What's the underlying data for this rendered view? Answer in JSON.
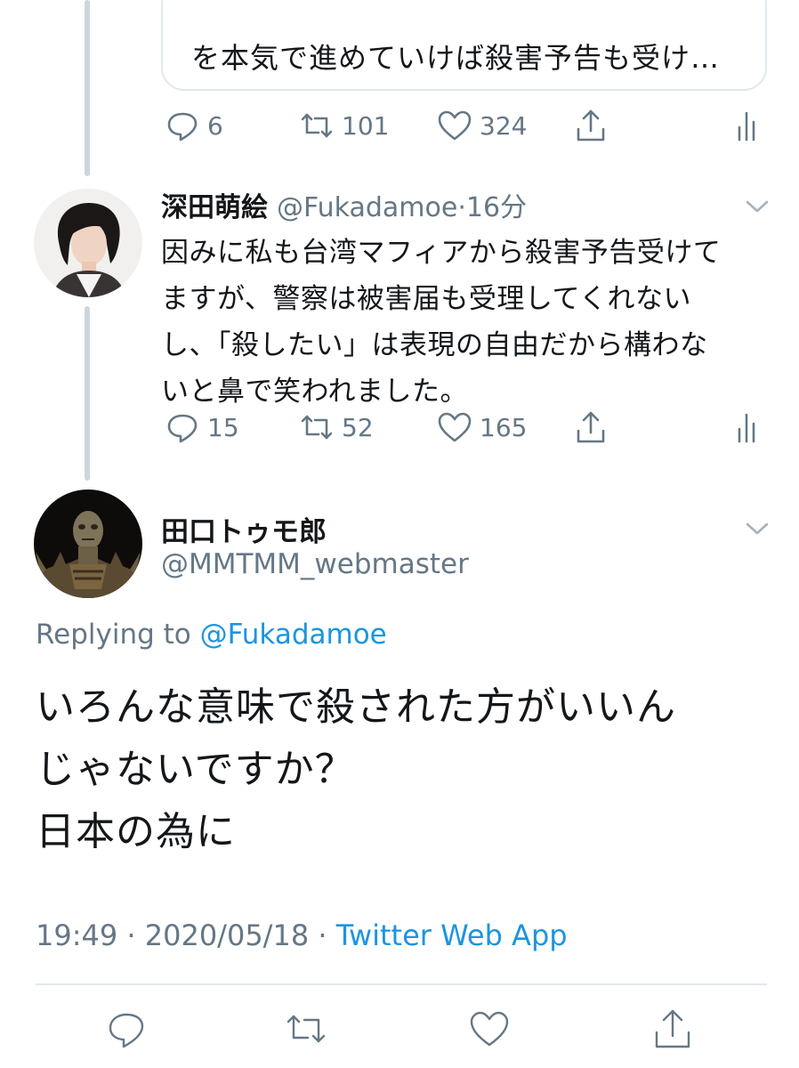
{
  "quoted_tweet": {
    "text_visible": "を本気で進めていけば殺害予告も受け…",
    "actions": {
      "replies": "6",
      "retweets": "101",
      "likes": "324"
    }
  },
  "reply_tweet": {
    "display_name": "深田萌絵",
    "handle": "@Fukadamoe",
    "separator": "·",
    "time": "16分",
    "lines": [
      "因みに私も台湾マフィアから殺害予告受けて",
      "ますが、警察は被害届も受理してくれない",
      "し、「殺したい」は表現の自由だから構わな",
      "いと鼻で笑われました。"
    ],
    "actions": {
      "replies": "15",
      "retweets": "52",
      "likes": "165"
    }
  },
  "main_tweet": {
    "display_name": "田口トゥモ郎",
    "handle": "@MMTMM_webmaster",
    "replying_prefix": "Replying to",
    "replying_to": "@Fukadamoe",
    "lines": [
      "いろんな意味で殺された方がいいん",
      "じゃないですか？",
      "日本の為に"
    ],
    "time": "19:49",
    "date": "2020/05/18",
    "separator": "·",
    "source": "Twitter Web App"
  },
  "icons": {
    "reply": "reply-icon",
    "retweet": "retweet-icon",
    "like": "heart-icon",
    "share": "share-icon",
    "analytics": "analytics-icon",
    "more": "chevron-down-icon"
  },
  "colors": {
    "text": "#14171a",
    "muted": "#657786",
    "link": "#1b95e0",
    "border": "#e1e8ed",
    "thread_line": "#ccd6dd"
  }
}
